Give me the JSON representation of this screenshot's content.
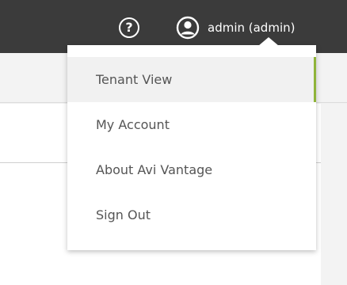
{
  "header": {
    "help_icon_glyph": "?",
    "user_label": "admin (admin)"
  },
  "user_dropdown": {
    "items": [
      {
        "label": "Tenant View",
        "active": true
      },
      {
        "label": "My Account"
      },
      {
        "label": "About Avi Vantage"
      },
      {
        "label": "Sign Out"
      }
    ]
  },
  "colors": {
    "header_bg": "#3b3b3b",
    "active_accent": "#8fb439",
    "menu_text": "#555555"
  }
}
